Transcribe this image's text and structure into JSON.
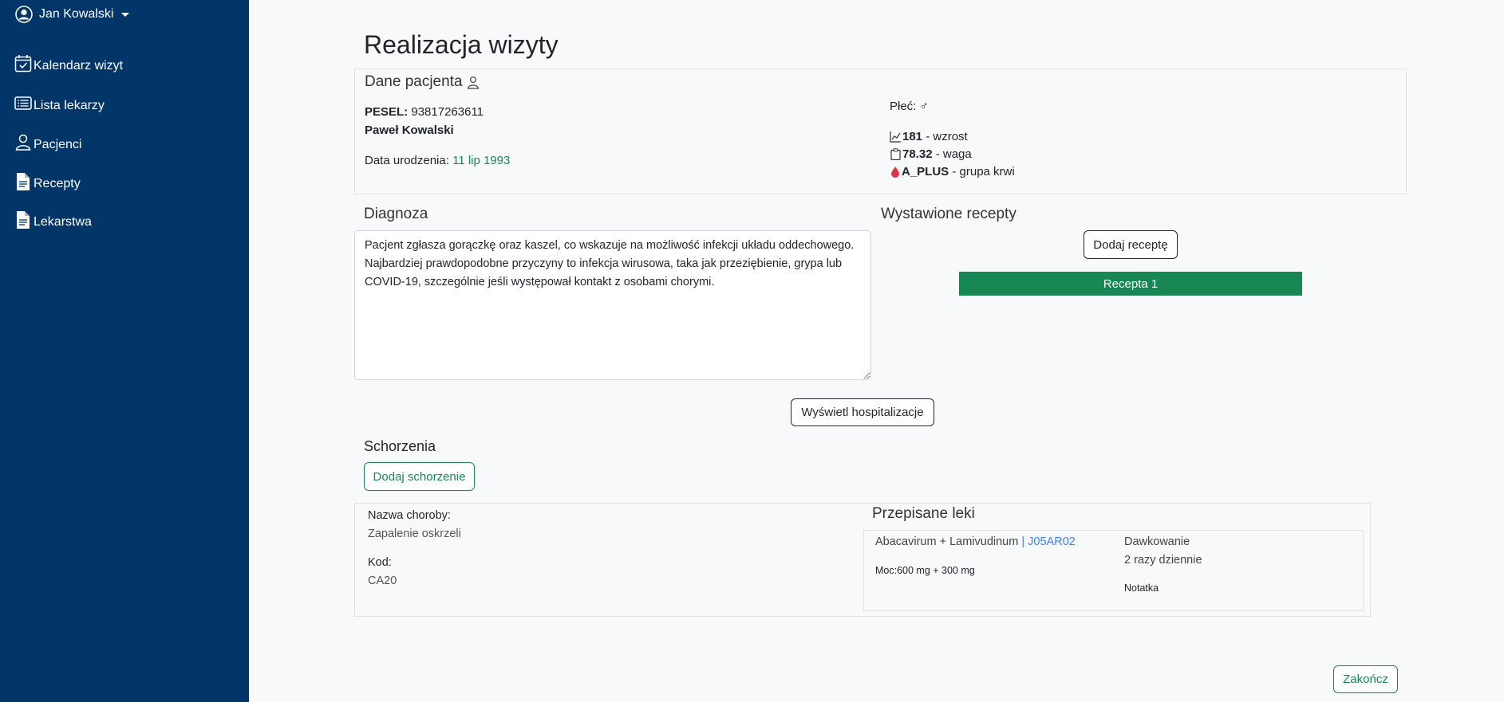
{
  "user": {
    "name": "Jan Kowalski"
  },
  "sidebar": {
    "items": [
      {
        "label": "Kalendarz wizyt",
        "icon": "calendar-check-icon"
      },
      {
        "label": "Lista lekarzy",
        "icon": "list-icon"
      },
      {
        "label": "Pacjenci",
        "icon": "person-icon"
      },
      {
        "label": "Recepty",
        "icon": "document-icon"
      },
      {
        "label": "Lekarstwa",
        "icon": "document-icon"
      }
    ]
  },
  "page": {
    "title": "Realizacja wizyty"
  },
  "patient": {
    "section_title": "Dane pacjenta",
    "pesel_label": "PESEL:",
    "pesel": "93817263611",
    "name": "Paweł Kowalski",
    "dob_label": "Data urodzenia:",
    "dob": "11 lip 1993",
    "sex_label": "Płeć:",
    "sex_symbol": "♂",
    "height_value": "181",
    "height_label": "- wzrost",
    "weight_value": "78.32",
    "weight_label": "- waga",
    "blood_value": "A_PLUS",
    "blood_label": "- grupa krwi"
  },
  "diagnosis": {
    "title": "Diagnoza",
    "text": "Pacjent zgłasza gorączkę oraz kaszel, co wskazuje na możliwość infekcji układu oddechowego. Najbardziej prawdopodobne przyczyny to infekcja wirusowa, taka jak przeziębienie, grypa lub COVID-19, szczególnie jeśli występował kontakt z osobami chorymi."
  },
  "prescriptions": {
    "title": "Wystawione recepty",
    "add_label": "Dodaj receptę",
    "items": [
      "Recepta 1"
    ]
  },
  "hospitalization": {
    "button_label": "Wyświetl hospitalizacje"
  },
  "conditions": {
    "title": "Schorzenia",
    "add_label": "Dodaj schorzenie",
    "items": [
      {
        "name_label": "Nazwa choroby:",
        "name": "Zapalenie oskrzeli",
        "code_label": "Kod:",
        "code": "CA20",
        "meds_title": "Przepisane leki",
        "meds": [
          {
            "name": "Abacavirum + Lamivudinum",
            "separator": "|",
            "atc": "J05AR02",
            "strength_label": "Moc:",
            "strength": "600 mg + 300 mg",
            "dosage_label": "Dawkowanie",
            "dosage": "2 razy dziennie",
            "note_label": "Notatka"
          }
        ]
      }
    ]
  },
  "footer": {
    "finish_label": "Zakończ"
  },
  "colors": {
    "sidebar": "#023669",
    "accent": "#198754",
    "link": "#3b82f6",
    "background": "#f8f9fa"
  }
}
